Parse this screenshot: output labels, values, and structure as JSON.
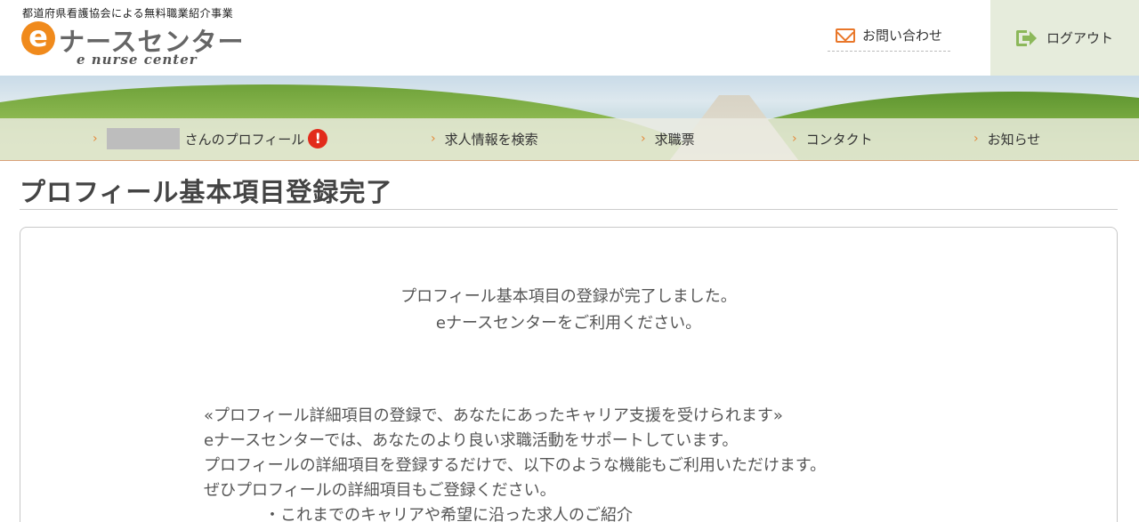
{
  "header": {
    "tagline": "都道府県看護協会による無料職業紹介事業",
    "logo_letter": "e",
    "logo_text": "ナースセンター",
    "logo_sub": "e nurse center",
    "contact_label": "お問い合わせ",
    "logout_label": "ログアウト"
  },
  "nav": {
    "items": [
      {
        "label": "さんのプロフィール"
      },
      {
        "label": "求人情報を検索"
      },
      {
        "label": "求職票"
      },
      {
        "label": "コンタクト"
      },
      {
        "label": "お知らせ"
      }
    ],
    "chevron": "›",
    "alert_mark": "!"
  },
  "page": {
    "title": "プロフィール基本項目登録完了"
  },
  "content": {
    "complete_line1": "プロフィール基本項目の登録が完了しました。",
    "complete_line2": "eナースセンターをご利用ください。",
    "detail_lines": [
      "«プロフィール詳細項目の登録で、あなたにあったキャリア支援を受けられます»",
      "eナースセンターでは、あなたのより良い求職活動をサポートしています。",
      "プロフィールの詳細項目を登録するだけで、以下のような機能もご利用いただけます。",
      "ぜひプロフィールの詳細項目もご登録ください。"
    ],
    "bullet_1": "・これまでのキャリアや希望に沿った求人のご紹介"
  },
  "colors": {
    "accent_orange": "#f08a1c",
    "logout_bg": "#e6ecdc",
    "logout_icon": "#8cb85a",
    "alert_red": "#e22b1b"
  }
}
